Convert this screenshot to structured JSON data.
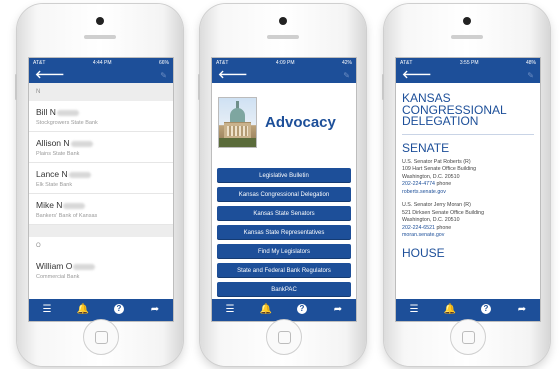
{
  "brand_color": "#1d4f99",
  "icons": {
    "back": "back-arrow-icon",
    "edit": "edit-icon",
    "menu": "menu-icon",
    "notifications": "bell-icon",
    "help": "help-icon",
    "share": "share-icon"
  },
  "tabbar": {
    "menu_glyph": "☰",
    "bell_glyph": "🔔",
    "help_glyph": "?",
    "share_glyph": "➦"
  },
  "nav": {
    "back_glyph": "🡐",
    "edit_glyph": "✎"
  },
  "phones": [
    {
      "status": {
        "carrier": "AT&T",
        "time": "4:44 PM",
        "battery": "66%"
      },
      "contacts": {
        "section_n": "N",
        "items": [
          {
            "name": "Bill N",
            "bank": "Stockgrowers State Bank"
          },
          {
            "name": "Allison N",
            "bank": "Plains State Bank"
          },
          {
            "name": "Lance N",
            "bank": "Elk State Bank"
          },
          {
            "name": "Mike N",
            "bank": "Bankers' Bank of Kansas"
          }
        ],
        "section_o": "O",
        "partial": {
          "name": "William O",
          "bank": "Commercial Bank"
        }
      }
    },
    {
      "status": {
        "carrier": "AT&T",
        "time": "4:09 PM",
        "battery": "42%"
      },
      "advocacy": {
        "title": "Advocacy",
        "menu": [
          "Legislative Bulletin",
          "Kansas Congressional Delegation",
          "Kansas State Senators",
          "Kansas State Representatives",
          "Find My Legislators",
          "State and Federal Bank Regulators",
          "BankPAC"
        ]
      }
    },
    {
      "status": {
        "carrier": "AT&T",
        "time": "3:55 PM",
        "battery": "48%"
      },
      "delegation": {
        "title_line1": "KANSAS",
        "title_line2": "CONGRESSIONAL",
        "title_line3": "DELEGATION",
        "senate_title": "SENATE",
        "senators": [
          {
            "name": "U.S. Senator Pat Roberts (R)",
            "office": "109 Hart Senate Office Building",
            "city": "Washington, D.C. 20510",
            "phone": "202-224-4774",
            "phone_label": "phone",
            "web": "roberts.senate.gov"
          },
          {
            "name": "U.S. Senator Jerry Moran (R)",
            "office": "521 Dirksen Senate Office Building",
            "city": "Washington, D.C. 20510",
            "phone": "202-224-6521",
            "phone_label": "phone",
            "web": "moran.senate.gov"
          }
        ],
        "house_title": "HOUSE"
      }
    }
  ]
}
